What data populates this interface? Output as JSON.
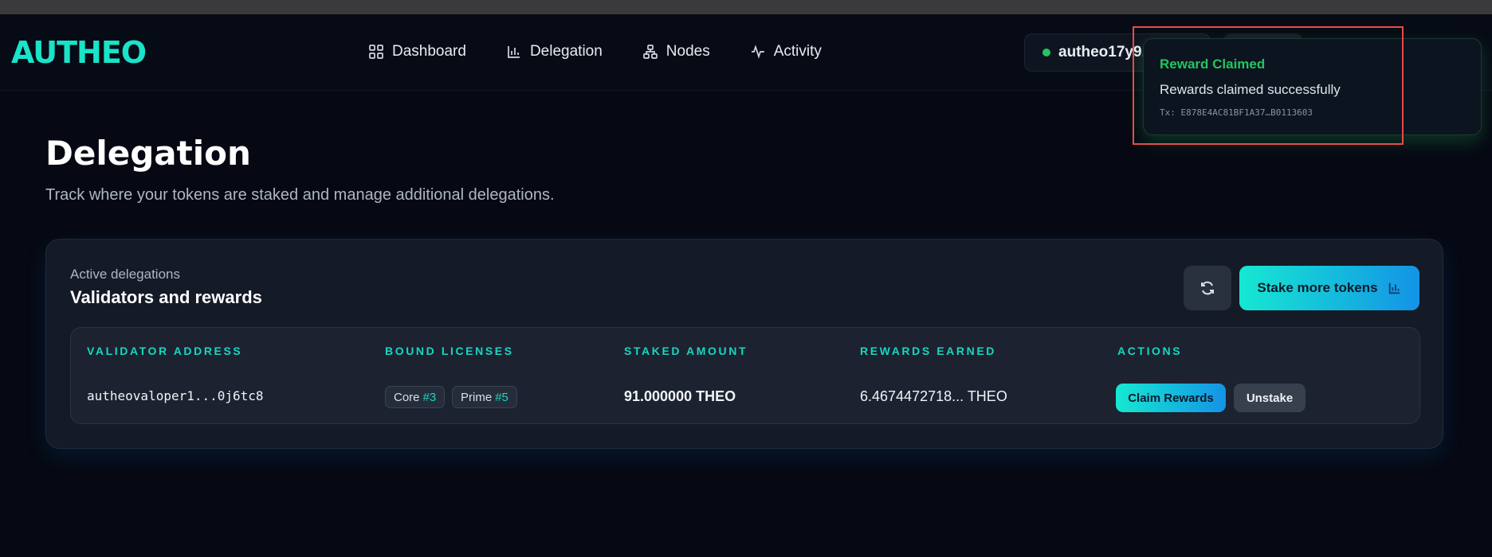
{
  "brand": {
    "logo_text": "AUTHEO",
    "accent": "#19e3c8"
  },
  "nav": {
    "items": [
      {
        "label": "Dashboard",
        "icon": "grid-icon"
      },
      {
        "label": "Delegation",
        "icon": "bar-chart-icon"
      },
      {
        "label": "Nodes",
        "icon": "network-icon"
      },
      {
        "label": "Activity",
        "icon": "activity-icon"
      }
    ]
  },
  "wallet": {
    "address": "autheo17y9...",
    "status_color": "#22c55e"
  },
  "toast": {
    "title": "Reward Claimed",
    "message": "Rewards claimed successfully",
    "tx": "Tx: E878E4AC81BF1A37…B0113603",
    "accent": "#22c55e"
  },
  "page": {
    "title": "Delegation",
    "subtitle": "Track where your tokens are staked and manage additional delegations."
  },
  "panel": {
    "kicker": "Active delegations",
    "heading": "Validators and rewards",
    "stake_label": "Stake more tokens"
  },
  "table": {
    "headers": [
      "VALIDATOR ADDRESS",
      "BOUND LICENSES",
      "STAKED AMOUNT",
      "REWARDS EARNED",
      "ACTIONS"
    ],
    "rows": [
      {
        "validator": "autheovaloper1...0j6tc8",
        "licenses": [
          {
            "name": "Core",
            "num": "#3"
          },
          {
            "name": "Prime",
            "num": "#5"
          }
        ],
        "staked": "91.000000 THEO",
        "rewards_value": "6.4674472718...",
        "rewards_unit": "THEO",
        "claim_label": "Claim Rewards",
        "unstake_label": "Unstake"
      }
    ]
  }
}
